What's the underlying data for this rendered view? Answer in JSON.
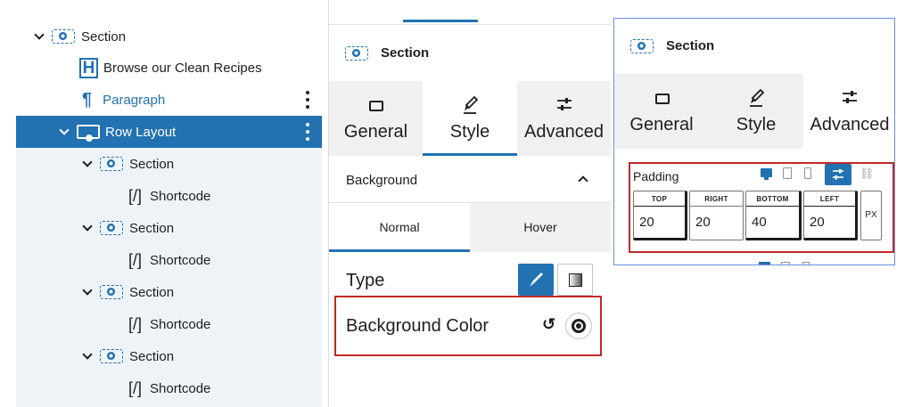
{
  "tree": {
    "items": [
      {
        "label": "Section",
        "type": "section"
      },
      {
        "label": "Browse our Clean Recipes",
        "type": "heading"
      },
      {
        "label": "Paragraph",
        "type": "paragraph"
      },
      {
        "label": "Row Layout",
        "type": "row"
      },
      {
        "label": "Section",
        "type": "section"
      },
      {
        "label": "Shortcode",
        "type": "shortcode"
      },
      {
        "label": "Section",
        "type": "section"
      },
      {
        "label": "Shortcode",
        "type": "shortcode"
      },
      {
        "label": "Section",
        "type": "section"
      },
      {
        "label": "Shortcode",
        "type": "shortcode"
      },
      {
        "label": "Section",
        "type": "section"
      },
      {
        "label": "Shortcode",
        "type": "shortcode"
      }
    ],
    "heading_glyph": "H",
    "paragraph_glyph": "¶",
    "shortcode_glyph": "[/]"
  },
  "style_panel": {
    "block_title": "Section",
    "tabs": [
      {
        "label": "General",
        "icon": "card-icon"
      },
      {
        "label": "Style",
        "icon": "brush-icon"
      },
      {
        "label": "Advanced",
        "icon": "sliders-icon"
      }
    ],
    "active_tab": "Style",
    "background_section": "Background",
    "state_tabs": [
      "Normal",
      "Hover"
    ],
    "type_label": "Type",
    "bg_color_label": "Background Color"
  },
  "advanced_panel": {
    "block_title": "Section",
    "tabs": [
      {
        "label": "General",
        "icon": "card-icon"
      },
      {
        "label": "Style",
        "icon": "brush-icon"
      },
      {
        "label": "Advanced",
        "icon": "sliders-icon"
      }
    ],
    "active_tab": "Advanced",
    "padding_label": "Padding",
    "fields": [
      {
        "label": "TOP",
        "value": "20"
      },
      {
        "label": "RIGHT",
        "value": "20"
      },
      {
        "label": "BOTTOM",
        "value": "40"
      },
      {
        "label": "LEFT",
        "value": "20"
      }
    ],
    "unit": "PX"
  },
  "colors": {
    "accent": "#2271b1",
    "highlight_outline": "#c02a2a",
    "tree_bg": "#f0f4f8",
    "panel_bg": "#f0f0f0"
  }
}
